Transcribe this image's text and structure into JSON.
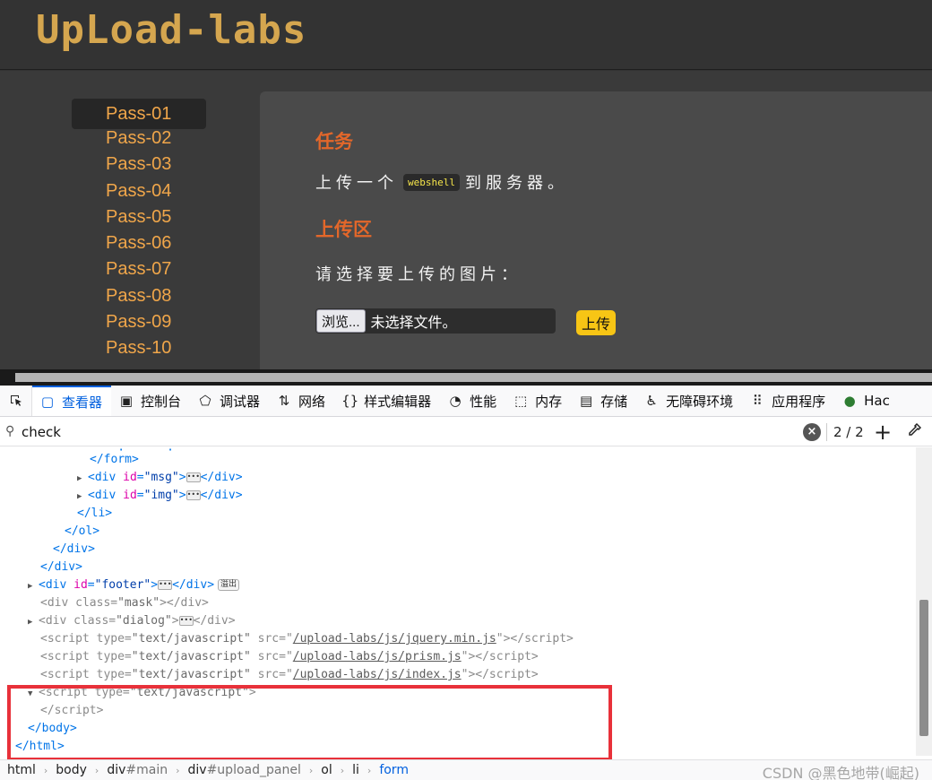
{
  "site": {
    "logo": "UpLoad-labs",
    "menu": [
      "Pass-01",
      "Pass-02",
      "Pass-03",
      "Pass-04",
      "Pass-05",
      "Pass-06",
      "Pass-07",
      "Pass-08",
      "Pass-09",
      "Pass-10"
    ],
    "active_item": "Pass-01",
    "panel": {
      "task_heading": "任务",
      "task_text_before": "上传一个",
      "task_code": "webshell",
      "task_text_after": "到服务器。",
      "upload_heading": "上传区",
      "choose_label": "请选择要上传的图片：",
      "browse_button": "浏览...",
      "file_status": "未选择文件。",
      "upload_button": "上传"
    },
    "colors": {
      "menu_text": "#f0a64a",
      "heading": "#e3672a",
      "upload_button": "#f7c515",
      "logo": "#d5a64f"
    }
  },
  "devtools": {
    "tabs": [
      {
        "label": "查看器",
        "icon": "inspector-icon"
      },
      {
        "label": "控制台",
        "icon": "console-icon"
      },
      {
        "label": "调试器",
        "icon": "debugger-icon"
      },
      {
        "label": "网络",
        "icon": "network-icon"
      },
      {
        "label": "样式编辑器",
        "icon": "style-editor-icon"
      },
      {
        "label": "性能",
        "icon": "performance-icon"
      },
      {
        "label": "内存",
        "icon": "memory-icon"
      },
      {
        "label": "存储",
        "icon": "storage-icon"
      },
      {
        "label": "无障碍环境",
        "icon": "accessibility-icon"
      },
      {
        "label": "应用程序",
        "icon": "application-icon"
      },
      {
        "label": "Hac",
        "icon": "hackbar-icon"
      }
    ],
    "selected_tab": "查看器",
    "search": {
      "value": "check",
      "count": "2 / 2"
    },
    "tree": {
      "form_close": "</form>",
      "msg_id": "\"msg\"",
      "img_id": "\"img\"",
      "footer_id": "\"footer\"",
      "overflow_badge": "溢出",
      "mask_class": "\"mask\"",
      "dialog_class": "\"dialog\"",
      "script_type": "\"text/javascript\"",
      "src_jquery": "/upload-labs/js/jquery.min.js",
      "src_prism": "/upload-labs/js/prism.js",
      "src_index": "/upload-labs/js/index.js"
    },
    "breadcrumbs": [
      {
        "tag": "html",
        "id": ""
      },
      {
        "tag": "body",
        "id": ""
      },
      {
        "tag": "div",
        "id": "#main"
      },
      {
        "tag": "div",
        "id": "#upload_panel"
      },
      {
        "tag": "ol",
        "id": ""
      },
      {
        "tag": "li",
        "id": ""
      },
      {
        "tag": "form",
        "id": ""
      }
    ]
  },
  "watermark": "CSDN @黑色地带(崛起)"
}
